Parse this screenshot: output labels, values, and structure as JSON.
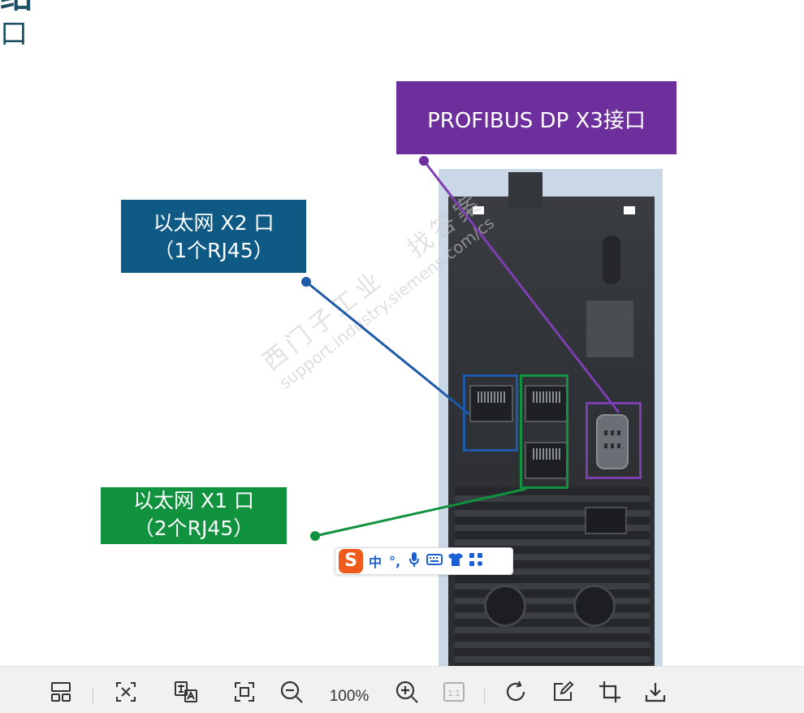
{
  "slide": {
    "heading_fragment": "绍",
    "subheading_fragment": "口"
  },
  "callouts": {
    "profibus": {
      "text": "PROFIBUS DP X3接口",
      "color": "#6d2f9c"
    },
    "ethernet_x2": {
      "line1": "以太网 X2 口",
      "line2": "（1个RJ45）",
      "color": "#0e5a85"
    },
    "ethernet_x1": {
      "line1": "以太网 X1 口",
      "line2": "（2个RJ45）",
      "color": "#10923e"
    }
  },
  "watermark": {
    "brand": "西门子工业",
    "slogan": "找答案",
    "url": "support.industry.siemens.com/cs"
  },
  "ime_toolbar": {
    "logo": "S",
    "items": [
      "中",
      "°,",
      "mic",
      "keyboard",
      "skin",
      "apps"
    ],
    "mode_label": "中",
    "punct_label": "°,"
  },
  "viewer_toolbar": {
    "zoom_level": "100%",
    "actual_size_label": "1:1",
    "buttons": [
      "layout-icon",
      "ocr-icon",
      "translate-icon",
      "fit-screen-icon",
      "zoom-out-icon",
      "zoom-in-icon",
      "actual-size-icon",
      "rotate-icon",
      "edit-icon",
      "crop-icon",
      "download-icon"
    ]
  },
  "colors": {
    "profibus": "#6d2f9c",
    "ethernet_x2": "#0e5a85",
    "ethernet_x1": "#10923e",
    "device_bg": "#c9d7e6",
    "toolbar_bg": "#f1f1f1"
  }
}
